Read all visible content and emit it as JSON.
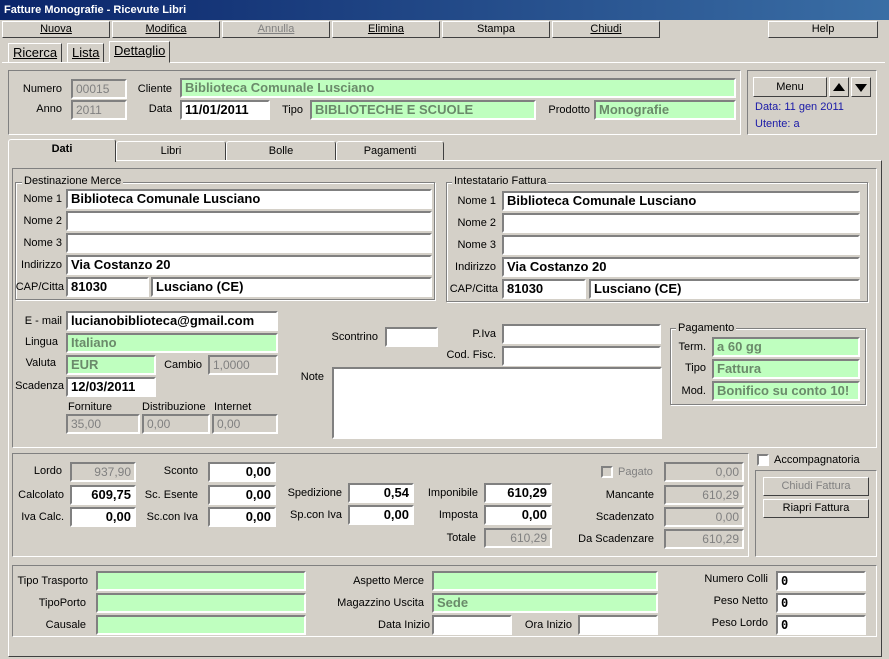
{
  "window": {
    "title": "Fatture Monografie - Ricevute Libri"
  },
  "menu": {
    "nuova": "Nuova",
    "modifica": "Modifica",
    "annulla": "Annulla",
    "elimina": "Elimina",
    "stampa": "Stampa",
    "chiudi": "Chiudi",
    "help": "Help"
  },
  "toptabs": {
    "ricerca": "Ricerca",
    "lista": "Lista",
    "dettaglio": "Dettaglio"
  },
  "header": {
    "numero_label": "Numero",
    "numero": "00015",
    "anno_label": "Anno",
    "anno": "2011",
    "cliente_label": "Cliente",
    "cliente": "Biblioteca Comunale Lusciano",
    "data_label": "Data",
    "data": "11/01/2011",
    "tipo_label": "Tipo",
    "tipo": "BIBLIOTECHE E SCUOLE",
    "prodotto_label": "Prodotto",
    "prodotto": "Monografie"
  },
  "side": {
    "menu_label": "Menu",
    "data_info": "Data: 11 gen 2011",
    "utente_info": "Utente: a"
  },
  "tabs": {
    "dati": "Dati",
    "libri": "Libri",
    "bolle": "Bolle",
    "pagamenti": "Pagamenti"
  },
  "destinazione": {
    "title": "Destinazione Merce",
    "nome1_label": "Nome 1",
    "nome1": "Biblioteca Comunale Lusciano",
    "nome2_label": "Nome 2",
    "nome2": "",
    "nome3_label": "Nome 3",
    "nome3": "",
    "indirizzo_label": "Indirizzo",
    "indirizzo": "Via Costanzo 20",
    "cap_label": "CAP/Citta",
    "cap": "81030",
    "citta": "Lusciano (CE)"
  },
  "intestatario": {
    "title": "Intestatario Fattura",
    "nome1_label": "Nome 1",
    "nome1": "Biblioteca Comunale Lusciano",
    "nome2_label": "Nome 2",
    "nome2": "",
    "nome3_label": "Nome 3",
    "nome3": "",
    "indirizzo_label": "Indirizzo",
    "indirizzo": "Via Costanzo 20",
    "cap_label": "CAP/Citta",
    "cap": "81030",
    "citta": "Lusciano (CE)"
  },
  "info": {
    "email_label": "E - mail",
    "email": "lucianobiblioteca@gmail.com",
    "lingua_label": "Lingua",
    "lingua": "Italiano",
    "valuta_label": "Valuta",
    "valuta": "EUR",
    "cambio_label": "Cambio",
    "cambio": "1,0000",
    "scadenza_label": "Scadenza",
    "scadenza": "12/03/2011",
    "forniture_label": "Forniture",
    "forniture": "35,00",
    "distribuzione_label": "Distribuzione",
    "distribuzione": "0,00",
    "internet_label": "Internet",
    "internet": "0,00",
    "scontrino_label": "Scontrino",
    "scontrino": "",
    "piva_label": "P.Iva",
    "piva": "",
    "codfisc_label": "Cod. Fisc.",
    "codfisc": "",
    "note_label": "Note",
    "note": ""
  },
  "pagamento": {
    "title": "Pagamento",
    "term_label": "Term.",
    "term": "a 60 gg",
    "tipo_label": "Tipo",
    "tipo": "Fattura",
    "mod_label": "Mod.",
    "mod": "Bonifico su conto 10!"
  },
  "totali": {
    "lordo_label": "Lordo",
    "lordo": "937,90",
    "calcolato_label": "Calcolato",
    "calcolato": "609,75",
    "ivacalc_label": "Iva Calc.",
    "ivacalc": "0,00",
    "sconto_label": "Sconto",
    "sconto": "0,00",
    "scesente_label": "Sc. Esente",
    "scesente": "0,00",
    "sconiva_label": "Sc.con Iva",
    "sconiva": "0,00",
    "spedizione_label": "Spedizione",
    "spedizione": "0,54",
    "spconiva_label": "Sp.con Iva",
    "spconiva": "0,00",
    "imponibile_label": "Imponibile",
    "imponibile": "610,29",
    "imposta_label": "Imposta",
    "imposta": "0,00",
    "totale_label": "Totale",
    "totale": "610,29",
    "pagato_label": "Pagato",
    "pagato": "0,00",
    "mancante_label": "Mancante",
    "mancante": "610,29",
    "scadenzato_label": "Scadenzato",
    "scadenzato": "0,00",
    "dascadenzare_label": "Da Scadenzare",
    "dascadenzare": "610,29"
  },
  "actions": {
    "accompagnatoria_label": "Accompagnatoria",
    "chiudi_fattura": "Chiudi Fattura",
    "riapri_fattura": "Riapri Fattura"
  },
  "trasporto": {
    "tipotrasporto_label": "Tipo Trasporto",
    "tipotrasporto": "",
    "tipoporto_label": "TipoPorto",
    "tipoporto": "",
    "causale_label": "Causale",
    "causale": "",
    "aspetto_label": "Aspetto Merce",
    "aspetto": "",
    "magazzino_label": "Magazzino Uscita",
    "magazzino": "Sede",
    "datainizio_label": "Data Inizio",
    "datainizio": "",
    "orainizio_label": "Ora Inizio",
    "orainizio": "",
    "numcolli_label": "Numero Colli",
    "numcolli": "0",
    "pesonetto_label": "Peso Netto",
    "pesonetto": "0",
    "pesolordo_label": "Peso Lordo",
    "pesolordo": "0"
  }
}
